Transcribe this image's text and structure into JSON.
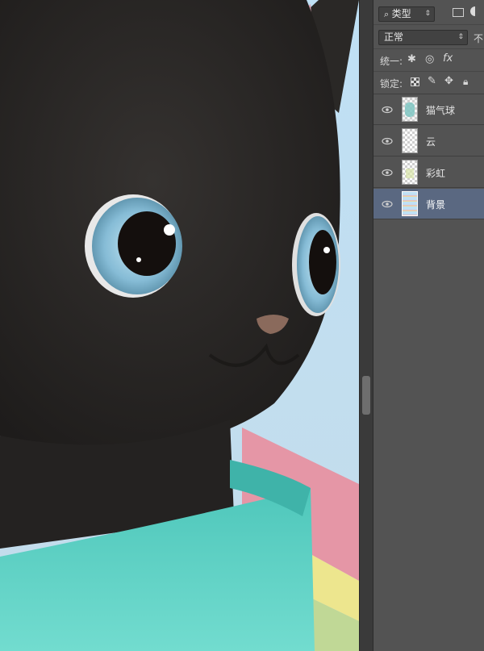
{
  "panel": {
    "filter_kind": "类型",
    "blend_mode": "正常",
    "opacity_label_partial": "不",
    "unify_label": "统一:",
    "fx_label": "fx",
    "lock_label": "锁定:"
  },
  "layers": [
    {
      "name": "猫气球",
      "visible": true,
      "selected": false
    },
    {
      "name": "云",
      "visible": true,
      "selected": false
    },
    {
      "name": "彩虹",
      "visible": true,
      "selected": false
    },
    {
      "name": "背景",
      "visible": true,
      "selected": true
    }
  ],
  "colors": {
    "panel_bg": "#535353",
    "selected_layer": "#5a6881",
    "cat_fur": "#2a2826",
    "eye_iris": "#8fc3dc",
    "cup": "#63d4c8",
    "sky": "#bfdff1",
    "rainbow_pink": "#e596a6",
    "rainbow_yellow": "#ede68e"
  }
}
